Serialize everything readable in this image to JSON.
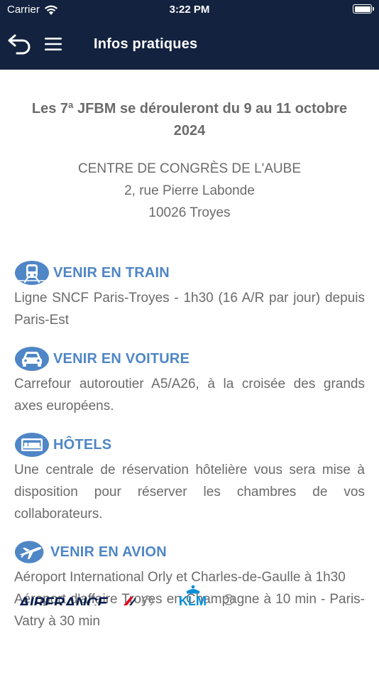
{
  "status_bar": {
    "carrier": "Carrier",
    "time": "3:22 PM"
  },
  "nav": {
    "title": "Infos pratiques",
    "back_icon": "back-arrow-icon",
    "menu_icon": "hamburger-menu-icon"
  },
  "intro": "Les 7ª JFBM se dérouleront du 9 au 11 octobre 2024",
  "venue": {
    "line1": "CENTRE DE CONGRÈS DE L'AUBE",
    "line2": "2, rue Pierre Labonde",
    "line3": "10026 Troyes"
  },
  "sections": [
    {
      "icon": "train-icon",
      "title": "VENIR EN TRAIN",
      "text": "Ligne SNCF Paris-Troyes - 1h30 (16 A/R par jour) depuis Paris-Est"
    },
    {
      "icon": "car-icon",
      "title": "VENIR EN VOITURE",
      "text": "Carrefour autoroutier A5/A26, à la croisée des grands axes européens."
    },
    {
      "icon": "bed-icon",
      "title": "HÔTELS",
      "text": "Une centrale de réservation hôtelière vous sera mise à disposition pour réserver les chambres de vos collaborateurs."
    },
    {
      "icon": "airplane-icon",
      "title": "VENIR EN AVION",
      "text1": "Aéroport International Orly et Charles-de-Gaulle à 1h30",
      "text2": "Aéroport d'affaire Troyes en Champagne à 10 min - Paris-Vatry à 30 min"
    }
  ],
  "logos": {
    "airfrance": "AIRFRANCE",
    "klm": "KLM"
  },
  "colors": {
    "header_bg": "#13223f",
    "accent": "#4f86c6",
    "text": "#6b6b6b"
  }
}
